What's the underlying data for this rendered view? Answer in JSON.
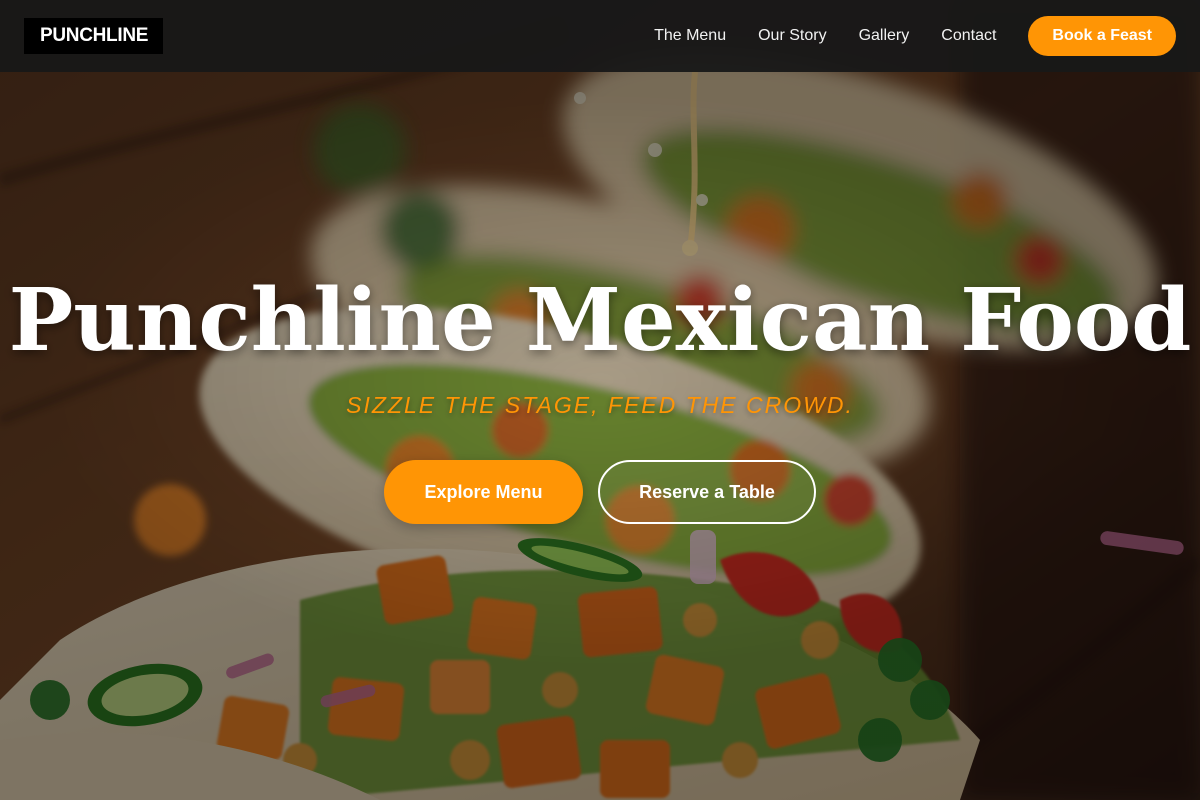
{
  "brand": {
    "logo_text": "PUNCHLINE"
  },
  "nav": {
    "links": [
      {
        "label": "The Menu"
      },
      {
        "label": "Our Story"
      },
      {
        "label": "Gallery"
      },
      {
        "label": "Contact"
      }
    ],
    "cta_label": "Book a Feast"
  },
  "hero": {
    "background_image": "tacos-with-sweet-potato-chickpeas-avocado-jalapeno",
    "title": "Punchline Mexican Food",
    "tagline": "SIZZLE THE STAGE, FEED THE CROWD.",
    "primary_button": "Explore Menu",
    "secondary_button": "Reserve a Table"
  },
  "colors": {
    "accent": "#ff9505",
    "nav_background": "#181818",
    "logo_background": "#000000",
    "text_light": "#ffffff"
  }
}
